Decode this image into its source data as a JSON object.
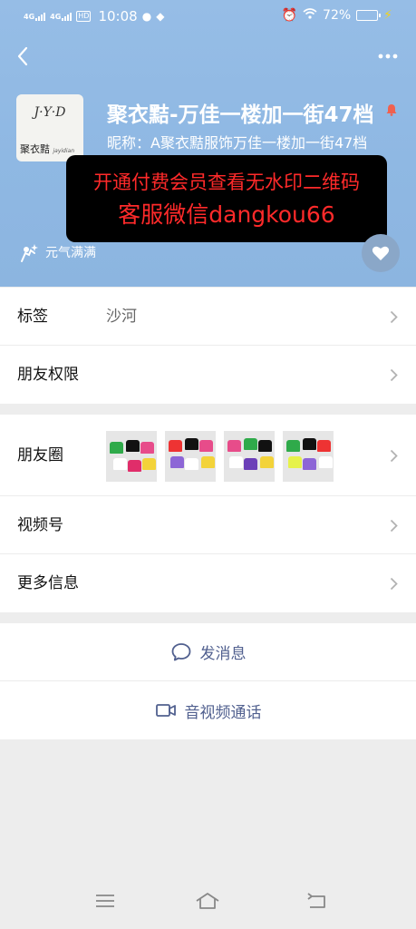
{
  "status_bar": {
    "signal1": "4G",
    "signal2": "4G",
    "hd_badge": "HD",
    "time": "10:08",
    "battery": "72%"
  },
  "profile": {
    "name": "聚衣黠-万佳一楼加一街47档",
    "nickname": "昵称：A聚衣黠服饰万佳一楼加一街47档",
    "avatar_top_text": "J·Y·D",
    "avatar_bottom_text": "聚衣黠",
    "avatar_bottom_sub": "jayidian",
    "mood": "元气满满"
  },
  "banner": {
    "line1": "开通付费会员查看无水印二维码",
    "line2": "客服微信dangkou66"
  },
  "rows_group1": [
    {
      "label": "标签",
      "value": "沙河"
    },
    {
      "label": "朋友权限",
      "value": ""
    }
  ],
  "rows_group2": [
    {
      "label": "朋友圈"
    },
    {
      "label": "视频号"
    },
    {
      "label": "更多信息"
    }
  ],
  "actions": {
    "message": "发消息",
    "call": "音视频通话"
  },
  "colors": {
    "header_bg": "#8fb8e3",
    "banner_text": "#ff2a2a",
    "action_text": "#51608f"
  }
}
